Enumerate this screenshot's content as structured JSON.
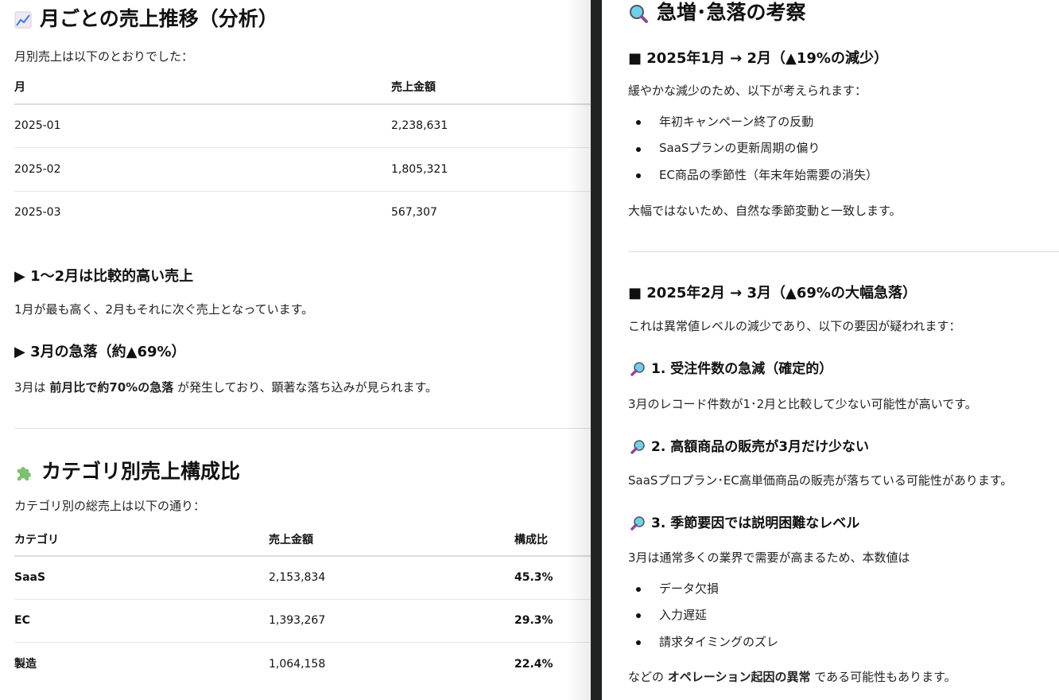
{
  "left": {
    "monthly": {
      "icon": "chart-increasing-icon",
      "title": "月ごとの売上推移（分析）",
      "intro": "月別売上は以下のとおりでした：",
      "headers": [
        "月",
        "売上金額"
      ],
      "rows": [
        [
          "2025-01",
          "2,238,631"
        ],
        [
          "2025-02",
          "1,805,321"
        ],
        [
          "2025-03",
          "567,307"
        ]
      ]
    },
    "point1": {
      "title": "▶ 1〜2月は比較的高い売上",
      "text": "1月が最も高く、2月もそれに次ぐ売上となっています。"
    },
    "point2": {
      "title": "▶ 3月の急落（約▲69%）",
      "text_pre": "3月は ",
      "text_bold": "前月比で約70%の急落",
      "text_post": " が発生しており、顕著な落ち込みが見られます。"
    },
    "category": {
      "icon": "puzzle-piece-icon",
      "title": "カテゴリ別売上構成比",
      "intro": "カテゴリ別の総売上は以下の通り：",
      "headers": [
        "カテゴリ",
        "売上金額",
        "構成比"
      ],
      "rows": [
        [
          "SaaS",
          "2,153,834",
          "45.3%"
        ],
        [
          "EC",
          "1,393,267",
          "29.3%"
        ],
        [
          "製造",
          "1,064,158",
          "22.4%"
        ]
      ]
    }
  },
  "right": {
    "icon": "magnifying-glass-icon",
    "title": "急増･急落の考察",
    "sec1": {
      "title": "■ 2025年1月 → 2月（▲19%の減少）",
      "intro": "緩やかな減少のため、以下が考えられます：",
      "bullets": [
        "年初キャンペーン終了の反動",
        "SaaSプランの更新周期の偏り",
        "EC商品の季節性（年末年始需要の消失）"
      ],
      "outro": "大幅ではないため、自然な季節変動と一致します。"
    },
    "sec2": {
      "title": "■ 2025年2月 → 3月（▲69%の大幅急落）",
      "intro": "これは異常値レベルの減少であり、以下の要因が疑われます：",
      "items": [
        {
          "title": "1. 受注件数の急減（確定的）",
          "text": "3月のレコード件数が1･2月と比較して少ない可能性が高いです。"
        },
        {
          "title": "2. 高額商品の販売が3月だけ少ない",
          "text": "SaaSプロプラン･EC高単価商品の販売が落ちている可能性があります。"
        },
        {
          "title": "3. 季節要因では説明困難なレベル",
          "text": "3月は通常多くの業界で需要が高まるため、本数値は"
        }
      ],
      "bullets": [
        "データ欠損",
        "入力遅延",
        "請求タイミングのズレ"
      ],
      "outro_pre": "などの ",
      "outro_bold": "オペレーション起因の異常",
      "outro_post": " である可能性もあります。"
    }
  }
}
